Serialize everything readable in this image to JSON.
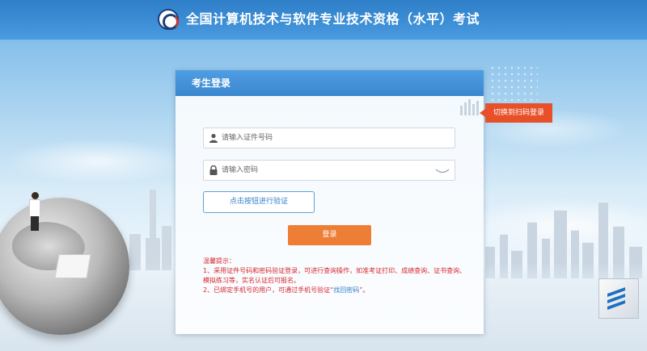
{
  "header": {
    "title": "全国计算机技术与软件专业技术资格（水平）考试",
    "logo_icon": "exam-logo-icon"
  },
  "card": {
    "title": "考生登录",
    "switch_label": "切换到扫码登录",
    "id_field": {
      "placeholder": "请输入证件号码",
      "value": "",
      "icon": "user-icon"
    },
    "password_field": {
      "placeholder": "请输入密码",
      "value": "",
      "icon": "lock-icon",
      "toggle_icon": "eye-closed-icon"
    },
    "verify_button": "点击按钮进行验证",
    "login_button": "登录",
    "tips": {
      "heading": "温馨提示：",
      "line1": "1、采用证件号码和密码验证登录，可进行查询操作，如准考证打印、成绩查询、证书查询、模拟练习等，实名认证后可报名。",
      "line2_prefix": "2、已绑定手机号的用户，可通过手机号验证“",
      "line2_link": "找回密码",
      "line2_suffix": "”。"
    }
  },
  "colors": {
    "header_blue": "#3a87cf",
    "accent_orange": "#ee7d36",
    "switch_tab": "#e8502a",
    "tip_red": "#d8282d",
    "link_blue": "#2f7ecb"
  }
}
